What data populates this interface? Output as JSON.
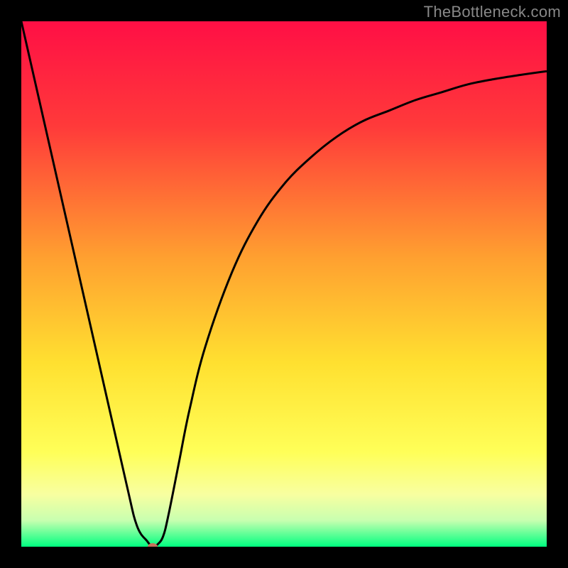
{
  "watermark": "TheBottleneck.com",
  "colors": {
    "frame": "#000000",
    "watermark": "#8a8a8a",
    "curve": "#000000",
    "marker_fill": "#c6725c",
    "gradient_stops": [
      {
        "pct": 0,
        "color": "#ff0f45"
      },
      {
        "pct": 20,
        "color": "#ff3a3a"
      },
      {
        "pct": 45,
        "color": "#ffa030"
      },
      {
        "pct": 65,
        "color": "#ffe030"
      },
      {
        "pct": 82,
        "color": "#ffff58"
      },
      {
        "pct": 90,
        "color": "#f8ffa0"
      },
      {
        "pct": 95,
        "color": "#c8ffb0"
      },
      {
        "pct": 100,
        "color": "#00ff80"
      }
    ]
  },
  "chart_data": {
    "type": "line",
    "title": "",
    "xlabel": "",
    "ylabel": "",
    "xlim": [
      0,
      100
    ],
    "ylim": [
      0,
      100
    ],
    "series": [
      {
        "name": "bottleneck-curve",
        "x": [
          0,
          5,
          10,
          15,
          20,
          22,
          24,
          25,
          26,
          27,
          28,
          30,
          32,
          35,
          40,
          45,
          50,
          55,
          60,
          65,
          70,
          75,
          80,
          85,
          90,
          95,
          100
        ],
        "values": [
          100,
          78,
          56,
          34,
          12,
          4,
          1,
          0,
          0.5,
          2,
          6,
          16,
          26,
          38,
          52,
          62,
          69,
          74,
          78,
          81,
          83,
          85,
          86.5,
          88,
          89,
          89.8,
          90.5
        ]
      }
    ],
    "marker": {
      "x": 25,
      "y": 0
    },
    "annotations": []
  }
}
